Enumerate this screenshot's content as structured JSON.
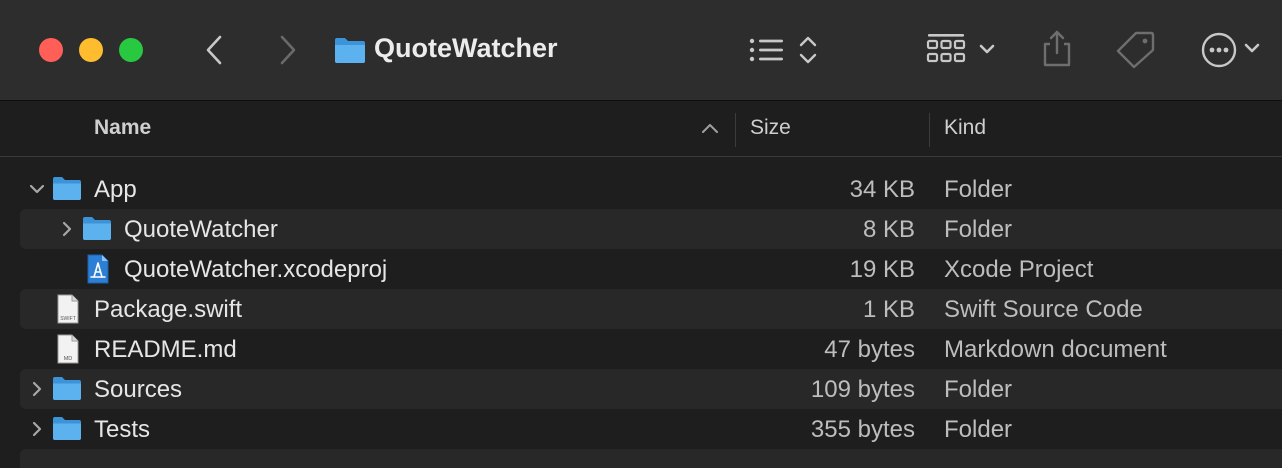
{
  "window": {
    "title": "QuoteWatcher"
  },
  "toolbar": {
    "back_icon": "chevron-left-icon",
    "forward_icon": "chevron-right-icon",
    "title_folder_icon": "folder-icon",
    "view_icon": "list-view-icon",
    "group_icon": "grid-group-icon",
    "share_icon": "share-icon",
    "tag_icon": "tag-icon",
    "more_icon": "ellipsis-circle-icon"
  },
  "columns": {
    "name": "Name",
    "size": "Size",
    "kind": "Kind"
  },
  "rows": [
    {
      "name": "App",
      "size": "34 KB",
      "kind": "Folder"
    },
    {
      "name": "QuoteWatcher",
      "size": "8 KB",
      "kind": "Folder"
    },
    {
      "name": "QuoteWatcher.xcodeproj",
      "size": "19 KB",
      "kind": "Xcode Project"
    },
    {
      "name": "Package.swift",
      "size": "1 KB",
      "kind": "Swift Source Code",
      "badge": "SWIFT"
    },
    {
      "name": "README.md",
      "size": "47 bytes",
      "kind": "Markdown document",
      "badge": "MD"
    },
    {
      "name": "Sources",
      "size": "109 bytes",
      "kind": "Folder"
    },
    {
      "name": "Tests",
      "size": "355 bytes",
      "kind": "Folder"
    }
  ],
  "colors": {
    "folder": "#4fa8ea",
    "folder_tab": "#3c93d8",
    "accent_red": "#ff5f57",
    "accent_yellow": "#febc2e",
    "accent_green": "#28c840"
  }
}
